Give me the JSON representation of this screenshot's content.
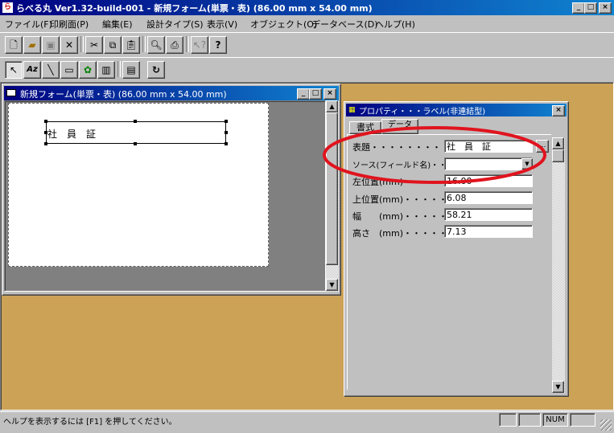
{
  "app": {
    "title": "らべる丸 Ver1.32-build-001 - 新規フォーム(単票・表) (86.00 mm x 54.00 mm)",
    "menu": [
      "ファイル(F)",
      "印刷面(P)",
      "編集(E)",
      "設計タイプ(S)",
      "表示(V)",
      "オブジェクト(O)",
      "データベース(D)",
      "ヘルプ(H)"
    ]
  },
  "form_window": {
    "title": "新規フォーム(単票・表) (86.00 mm x 54.00 mm)",
    "label_text": "社　員　証"
  },
  "property_panel": {
    "title": "プロパティ・・・ラベル(非連結型)",
    "tabs": [
      "書式",
      "データ"
    ],
    "fields": [
      {
        "label": "表題・・・・・・・・・・・・",
        "value": "社　員　証"
      },
      {
        "label": "ソース(フィールド名)・・・・",
        "value": ""
      },
      {
        "label": "左位置(mm)・・・・・・・・",
        "value": "16.00"
      },
      {
        "label": "上位置(mm)・・・・・・・・",
        "value": "6.08"
      },
      {
        "label": "幅　　(mm)・・・・・・・・",
        "value": "58.21"
      },
      {
        "label": "高さ　(mm)・・・・・・・・",
        "value": "7.13"
      }
    ],
    "ellipsis": "…"
  },
  "status": {
    "message": "ヘルプを表示するには [F1] を押してください。",
    "num": "NUM"
  },
  "colors": {
    "mdi_background": "#cca257",
    "title_active": "#000080",
    "highlight_ring": "#e0141e"
  }
}
